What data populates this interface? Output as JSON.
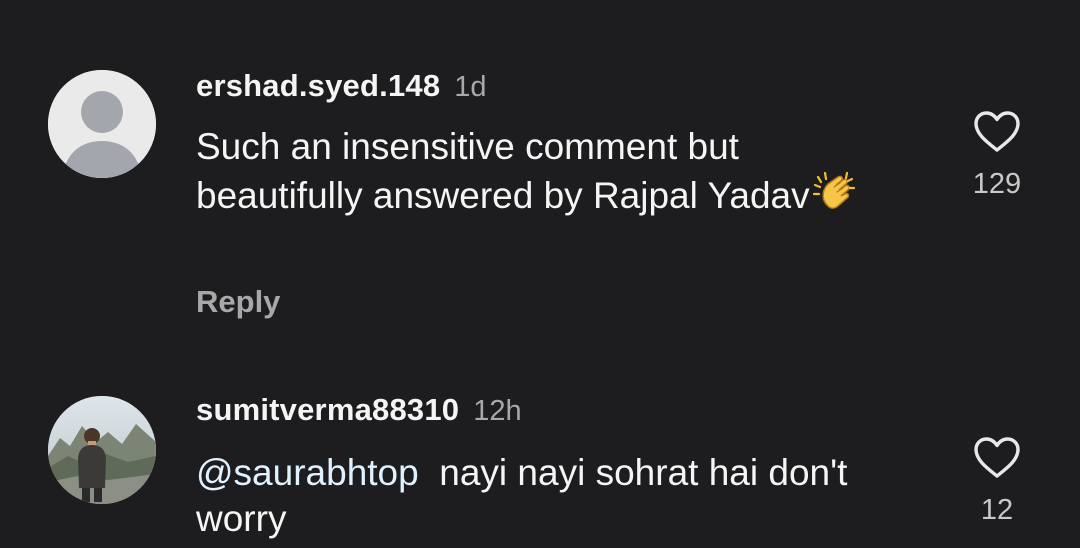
{
  "comments": [
    {
      "username": "ershad.syed.148",
      "time": "1d",
      "text": "Such an insensitive comment but beautifully answered by Rajpal Yadav",
      "emoji": "clapping-hands",
      "reply_label": "Reply",
      "likes": "129",
      "avatar": "default-avatar"
    },
    {
      "username": "sumitverma88310",
      "time": "12h",
      "mention": "@saurabhtop",
      "text": "nayi nayi sohrat hai don't worry",
      "likes": "12",
      "avatar": "user-photo"
    }
  ],
  "icons": {
    "like": "heart-outline-icon"
  },
  "colors": {
    "background": "#1d1d1f",
    "text": "#f5f5f5",
    "secondary": "#a8a8a8",
    "mention": "#e0f1ff"
  }
}
